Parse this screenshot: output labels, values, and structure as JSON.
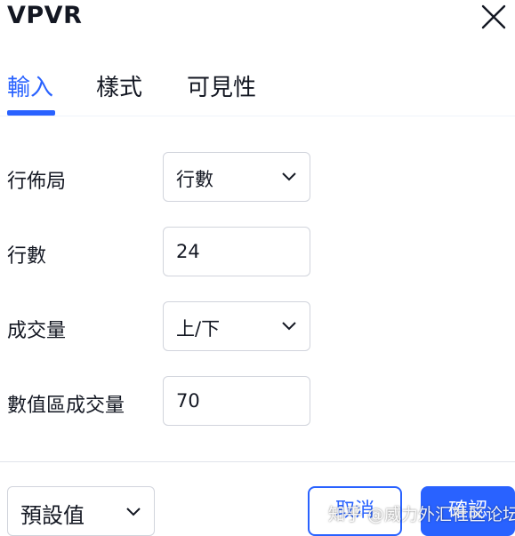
{
  "dialog": {
    "title": "VPVR"
  },
  "tabs": [
    {
      "label": "輸入",
      "active": true
    },
    {
      "label": "樣式",
      "active": false
    },
    {
      "label": "可見性",
      "active": false
    }
  ],
  "rows": [
    {
      "label": "行佈局",
      "type": "select",
      "value": "行數"
    },
    {
      "label": "行數",
      "type": "input",
      "value": "24"
    },
    {
      "label": "成交量",
      "type": "select",
      "value": "上/下"
    },
    {
      "label": "數值區成交量",
      "type": "input",
      "value": "70"
    }
  ],
  "footer": {
    "preset_label": "預設值",
    "cancel_label": "取消",
    "ok_label": "確認"
  },
  "watermark": "知乎 @威力外汇社区论坛",
  "colors": {
    "accent": "#2962ff",
    "border": "#d1d4dc",
    "text": "#131722"
  },
  "icons": {
    "close": "close-icon",
    "chevron": "chevron-down-icon"
  }
}
